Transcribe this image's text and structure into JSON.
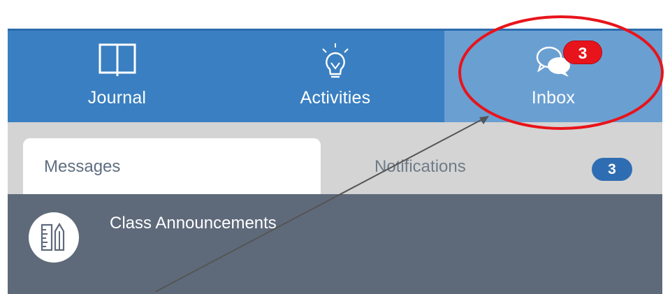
{
  "nav": {
    "items": [
      {
        "label": "Journal",
        "icon": "book-icon"
      },
      {
        "label": "Activities",
        "icon": "lightbulb-icon"
      },
      {
        "label": "Inbox",
        "icon": "chat-bubbles-icon"
      }
    ],
    "inbox_badge": "3",
    "active_color": "#6a9fd2",
    "bar_color": "#3a7fc1"
  },
  "tabs": {
    "messages_label": "Messages",
    "notifications_label": "Notifications",
    "notifications_count": "3"
  },
  "messages": [
    {
      "title": "Class Announcements",
      "icon": "ruler-pencil-icon"
    }
  ],
  "annotation": {
    "circle_color": "#e8141b",
    "arrow_color": "#555555"
  }
}
